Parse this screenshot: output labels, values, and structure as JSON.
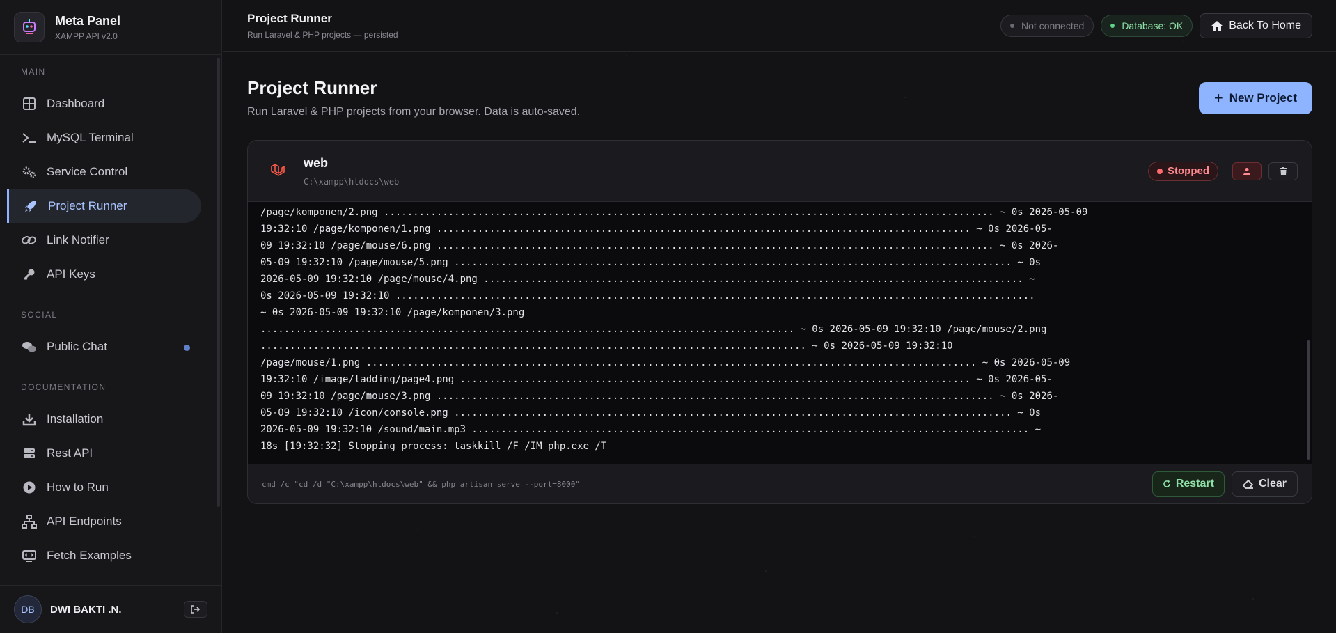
{
  "colors": {
    "accent": "#8eb4ff",
    "success": "#5fd38a",
    "danger": "#ff6b70",
    "background": "#131316"
  },
  "brand": {
    "title": "Meta Panel",
    "subtitle": "XAMPP API v2.0",
    "logo_icon": "robot-logo-icon"
  },
  "sidebar": {
    "sections": {
      "main": "MAIN",
      "social": "SOCIAL",
      "documentation": "DOCUMENTATION"
    },
    "main_items": [
      {
        "label": "Dashboard",
        "icon": "grid-icon"
      },
      {
        "label": "MySQL Terminal",
        "icon": "terminal-icon"
      },
      {
        "label": "Service Control",
        "icon": "gears-icon"
      },
      {
        "label": "Project Runner",
        "icon": "rocket-icon",
        "active": true
      },
      {
        "label": "Link Notifier",
        "icon": "link-icon"
      },
      {
        "label": "API Keys",
        "icon": "key-icon"
      }
    ],
    "social_items": [
      {
        "label": "Public Chat",
        "icon": "chat-icon"
      }
    ],
    "doc_items": [
      {
        "label": "Installation",
        "icon": "download-icon"
      },
      {
        "label": "Rest API",
        "icon": "server-icon"
      },
      {
        "label": "How to Run",
        "icon": "play-icon"
      },
      {
        "label": "API Endpoints",
        "icon": "sitemap-icon"
      },
      {
        "label": "Fetch Examples",
        "icon": "code-icon"
      }
    ]
  },
  "user": {
    "initials": "DB",
    "name": "DWI BAKTI .N."
  },
  "topbar": {
    "title": "Project Runner",
    "subtitle": "Run Laravel & PHP projects — persisted",
    "connection_status": "Not connected",
    "database_status": "Database: OK",
    "home_label": "Back To Home"
  },
  "page": {
    "title": "Project Runner",
    "subtitle": "Run Laravel & PHP projects from your browser. Data is auto-saved.",
    "new_project_label": "New Project"
  },
  "project": {
    "name": "web",
    "path": "C:\\xampp\\htdocs\\web",
    "status": "Stopped",
    "console_lines": [
      "/page/komponen/2.png ........................................................................................................ ~ 0s 2026-05-09",
      "19:32:10 /page/komponen/1.png ........................................................................................... ~ 0s 2026-05-",
      "09 19:32:10 /page/mouse/6.png ............................................................................................... ~ 0s 2026-",
      "05-09 19:32:10 /page/mouse/5.png ............................................................................................... ~ 0s",
      "2026-05-09 19:32:10 /page/mouse/4.png ............................................................................................ ~",
      "0s 2026-05-09 19:32:10 .............................................................................................................",
      "~ 0s 2026-05-09 19:32:10 /page/komponen/3.png",
      "........................................................................................... ~ 0s 2026-05-09 19:32:10 /page/mouse/2.png",
      "............................................................................................. ~ 0s 2026-05-09 19:32:10",
      "/page/mouse/1.png ........................................................................................................ ~ 0s 2026-05-09",
      "19:32:10 /image/ladding/page4.png ....................................................................................... ~ 0s 2026-05-",
      "09 19:32:10 /page/mouse/3.png ............................................................................................... ~ 0s 2026-",
      "05-09 19:32:10 /icon/console.png ............................................................................................... ~ 0s",
      "2026-05-09 19:32:10 /sound/main.mp3 ............................................................................................... ~",
      "18s [19:32:32] Stopping process: taskkill /F /IM php.exe /T"
    ],
    "command": "cmd /c \"cd /d \"C:\\xampp\\htdocs\\web\" && php artisan serve --port=8000\"",
    "restart_label": "Restart",
    "clear_label": "Clear"
  }
}
